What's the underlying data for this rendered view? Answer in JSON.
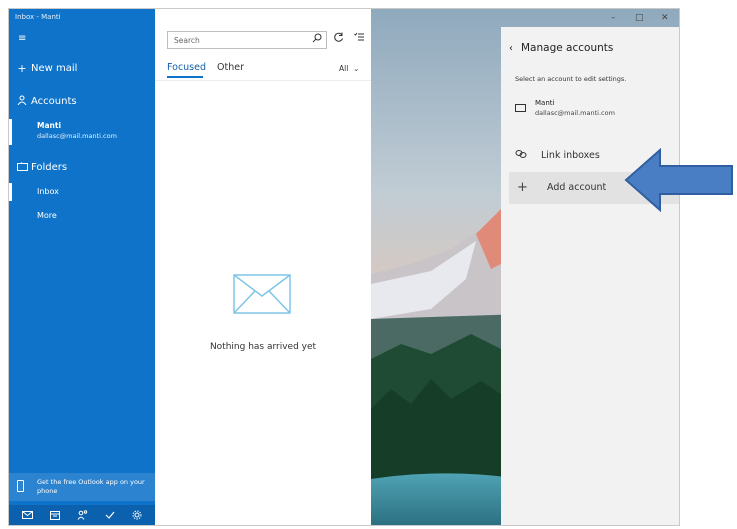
{
  "window": {
    "title": "Inbox - Manti",
    "controls": {
      "minimize": "–",
      "maximize": "□",
      "close": "✕"
    }
  },
  "sidebar": {
    "menu_icon": "≡",
    "new_mail": {
      "icon": "+",
      "label": "New mail"
    },
    "accounts": {
      "icon": "user-icon",
      "label": "Accounts"
    },
    "account": {
      "name": "Manti",
      "email": "dallasc@mail.manti.com"
    },
    "folders": {
      "icon": "folder-icon",
      "label": "Folders"
    },
    "folder_items": [
      "Inbox",
      "More"
    ],
    "promo": {
      "text": "Get the free Outlook app on your phone"
    },
    "bottom_icons": [
      "mail-icon",
      "calendar-icon",
      "people-icon",
      "todo-icon",
      "settings-icon"
    ]
  },
  "message_list": {
    "search": {
      "placeholder": "Search"
    },
    "tabs": [
      "Focused",
      "Other"
    ],
    "filter": "All",
    "empty_message": "Nothing has arrived yet"
  },
  "manage_panel": {
    "title": "Manage accounts",
    "hint": "Select an account to edit settings.",
    "account": {
      "name": "Manti",
      "email": "dallasc@mail.manti.com"
    },
    "link_inboxes": "Link inboxes",
    "add_account": "Add account"
  },
  "colors": {
    "sidebar": "#0f73c9",
    "accent": "#0f73c9",
    "panel": "#f2f2f2",
    "arrow": "#4a7ec4"
  }
}
